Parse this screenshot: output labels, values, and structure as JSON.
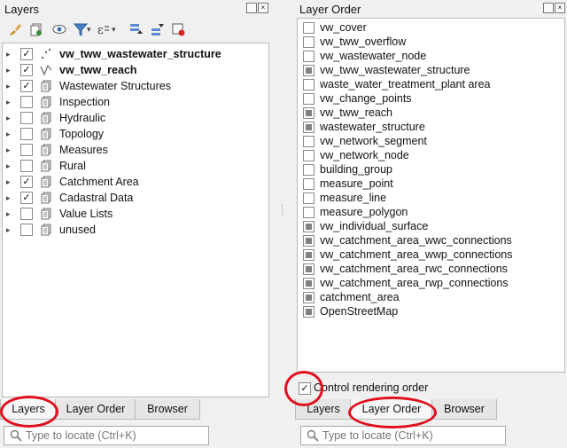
{
  "layers_panel": {
    "title": "Layers",
    "close_glyph": "×",
    "float_glyph": "▫",
    "rows": [
      {
        "label": "vw_tww_wastewater_structure",
        "checked": true,
        "bold": true,
        "icon": "point-layer-icon"
      },
      {
        "label": "vw_tww_reach",
        "checked": true,
        "bold": true,
        "icon": "line-layer-icon"
      },
      {
        "label": "Wastewater Structures",
        "checked": true,
        "bold": false,
        "icon": "group-icon"
      },
      {
        "label": "Inspection",
        "checked": false,
        "bold": false,
        "icon": "group-icon"
      },
      {
        "label": "Hydraulic",
        "checked": false,
        "bold": false,
        "icon": "group-icon"
      },
      {
        "label": "Topology",
        "checked": false,
        "bold": false,
        "icon": "group-icon"
      },
      {
        "label": "Measures",
        "checked": false,
        "bold": false,
        "icon": "group-icon"
      },
      {
        "label": "Rural",
        "checked": false,
        "bold": false,
        "icon": "group-icon"
      },
      {
        "label": "Catchment Area",
        "checked": true,
        "bold": false,
        "icon": "group-icon"
      },
      {
        "label": "Cadastral Data",
        "checked": true,
        "bold": false,
        "icon": "group-icon"
      },
      {
        "label": "Value Lists",
        "checked": false,
        "bold": false,
        "icon": "group-icon"
      },
      {
        "label": "unused",
        "checked": false,
        "bold": false,
        "icon": "group-icon"
      }
    ],
    "check_glyph": "✓",
    "expander_glyph": "▸",
    "tabs": [
      "Layers",
      "Layer Order",
      "Browser"
    ],
    "active_tab": 0,
    "search_placeholder": "Type to locate (Ctrl+K)"
  },
  "order_panel": {
    "title": "Layer Order",
    "items": [
      {
        "label": "vw_cover",
        "checked": false
      },
      {
        "label": "vw_tww_overflow",
        "checked": false
      },
      {
        "label": "vw_wastewater_node",
        "checked": false
      },
      {
        "label": "vw_tww_wastewater_structure",
        "checked": true
      },
      {
        "label": "waste_water_treatment_plant area",
        "checked": false
      },
      {
        "label": "vw_change_points",
        "checked": false
      },
      {
        "label": "vw_tww_reach",
        "checked": true
      },
      {
        "label": "wastewater_structure",
        "checked": true
      },
      {
        "label": "vw_network_segment",
        "checked": false
      },
      {
        "label": "vw_network_node",
        "checked": false
      },
      {
        "label": "building_group",
        "checked": false
      },
      {
        "label": "measure_point",
        "checked": false
      },
      {
        "label": "measure_line",
        "checked": false
      },
      {
        "label": "measure_polygon",
        "checked": false
      },
      {
        "label": "vw_individual_surface",
        "checked": true
      },
      {
        "label": "vw_catchment_area_wwc_connections",
        "checked": true
      },
      {
        "label": "vw_catchment_area_wwp_connections",
        "checked": true
      },
      {
        "label": "vw_catchment_area_rwc_connections",
        "checked": true
      },
      {
        "label": "vw_catchment_area_rwp_connections",
        "checked": true
      },
      {
        "label": "catchment_area",
        "checked": true
      },
      {
        "label": "OpenStreetMap",
        "checked": true
      }
    ],
    "control_rendering_order_label": "Control rendering order",
    "control_rendering_order_checked": true,
    "tabs": [
      "Layers",
      "Layer Order",
      "Browser"
    ],
    "active_tab": 1,
    "search_placeholder": "Type to locate (Ctrl+K)"
  },
  "colors": {
    "annotation_red": "#e0101e",
    "group_icon": "#6a6a6a"
  }
}
